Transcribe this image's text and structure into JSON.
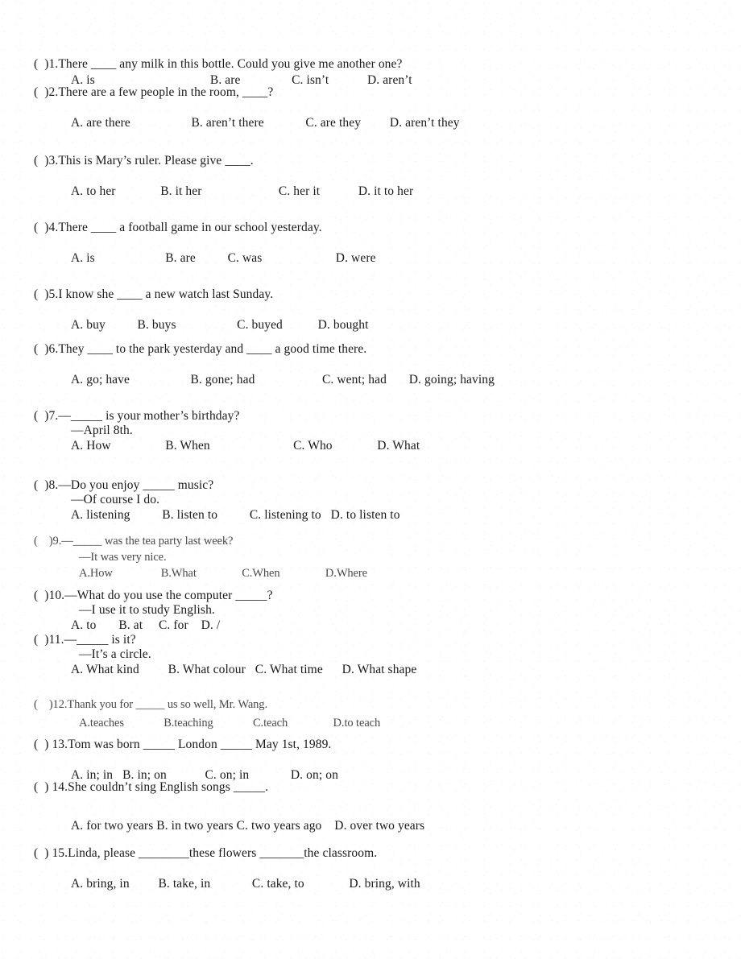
{
  "document": {
    "type": "english-grammar-worksheet",
    "page_background": "#ffffff",
    "text_color": "#1a1a1a"
  },
  "questions": [
    {
      "marker": "(  )1.",
      "stem": "There ____ any milk in this bottle. Could you give me another one?",
      "reply": "",
      "options_line": "A. is                                    B. are                C. isn’t            D. aren’t"
    },
    {
      "marker": "(  )2.",
      "stem": "There are a few people in the room, ____?",
      "reply": "",
      "options_line": "A. are there                   B. aren’t there             C. are they         D. aren’t they"
    },
    {
      "marker": "(  )3.",
      "stem": "This is Mary’s ruler. Please give ____.",
      "reply": "",
      "options_line": "A. to her              B. it her                        C. her it            D. it to her"
    },
    {
      "marker": "(  )4.",
      "stem": "There ____ a football game in our school yesterday.",
      "reply": "",
      "options_line": "A. is                      B. are          C. was                       D. were"
    },
    {
      "marker": "(  )5.",
      "stem": "I know she ____ a new watch last Sunday.",
      "reply": "",
      "options_line": "A. buy          B. buys                   C. buyed           D. bought"
    },
    {
      "marker": "(  )6.",
      "stem": "They ____ to the park yesterday and ____ a good time there.",
      "reply": "",
      "options_line": "A. go; have                   B. gone; had                     C. went; had       D. going; having"
    },
    {
      "marker": "(  )7.",
      "stem": "—_____ is your mother’s birthday?",
      "reply": "—April 8th.",
      "options_line": "A. How                 B. When                          C. Who              D. What"
    },
    {
      "marker": "(  )8.",
      "stem": "—Do you enjoy _____ music?",
      "reply": "—Of course I do.",
      "options_line": "A. listening          B. listen to          C. listening to   D. to listen to"
    },
    {
      "marker": "(    )9.",
      "stem": "—_____ was the tea party last week?",
      "reply": "—It was very nice.",
      "options_line": "A.How                 B.What                C.When                D.Where"
    },
    {
      "marker": "(  )10.",
      "stem": "—What do you use the computer _____?",
      "reply": "—I use it to study English.",
      "options_line": "A. to       B. at     C. for    D. /"
    },
    {
      "marker": "(  )11.",
      "stem": "—_____ is it?",
      "reply": "—It’s a circle.",
      "options_line": "A. What kind         B. What colour   C. What time      D. What shape"
    },
    {
      "marker": "(    )12.",
      "stem": "Thank you for _____ us so well, Mr. Wang.",
      "reply": "",
      "options_line": "A.teaches              B.teaching              C.teach                D.to teach"
    },
    {
      "marker": "(  ) 13.",
      "stem": "Tom was born _____ London _____ May 1st, 1989.",
      "reply": "",
      "options_line": "A. in; in   B. in; on            C. on; in             D. on; on"
    },
    {
      "marker": "(  ) 14.",
      "stem": "She couldn’t sing English songs _____.",
      "reply": "",
      "options_line": "A. for two years B. in two years C. two years ago    D. over two years"
    },
    {
      "marker": "(  ) 15.",
      "stem": "Linda, please ________these flowers _______the classroom.",
      "reply": "",
      "options_line": "A. bring, in         B. take, in             C. take, to              D. bring, with"
    }
  ]
}
